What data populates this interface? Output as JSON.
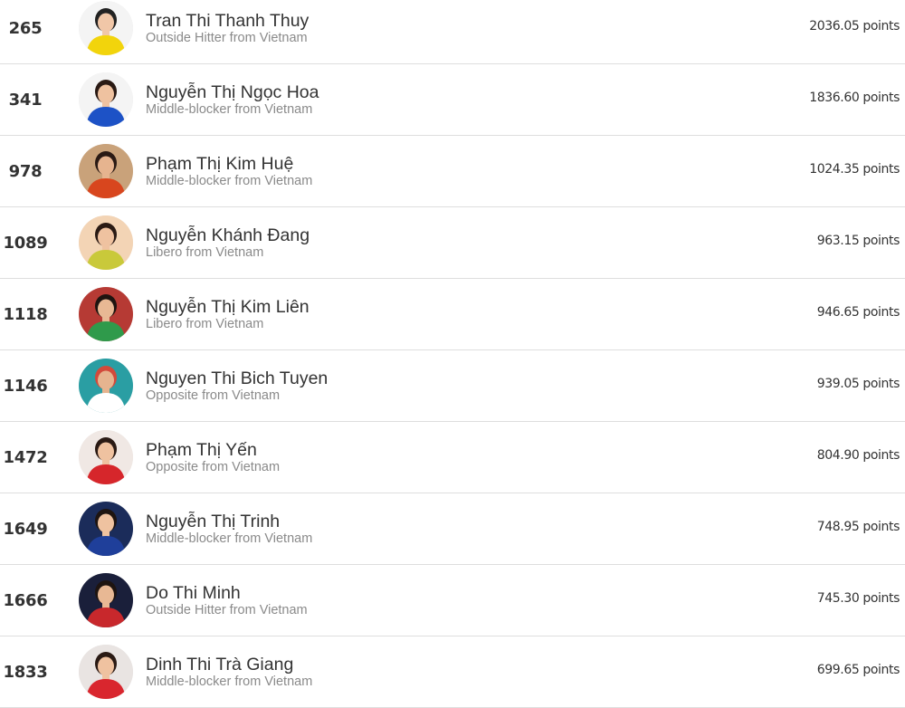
{
  "players": [
    {
      "rank": "265",
      "name": "Tran Thi Thanh Thuy",
      "role": "Outside Hitter from Vietnam",
      "points": "2036.05 points",
      "bg": "#f4f4f4",
      "shirt": "#f2d40c",
      "hair": "#222222",
      "skin": "#f1c7a8",
      "photo_icon": "player-avatar-icon"
    },
    {
      "rank": "341",
      "name": "Nguyễn Thị Ngọc Hoa",
      "role": "Middle-blocker from Vietnam",
      "points": "1836.60 points",
      "bg": "#f4f4f4",
      "shirt": "#1d52c6",
      "hair": "#2a1a14",
      "skin": "#efc2a0",
      "photo_icon": "player-avatar-icon"
    },
    {
      "rank": "978",
      "name": "Phạm Thị Kim Huệ",
      "role": "Middle-blocker from Vietnam",
      "points": "1024.35 points",
      "bg": "#c9a27a",
      "shirt": "#d8461e",
      "hair": "#2a1a14",
      "skin": "#e6b48f",
      "photo_icon": "player-avatar-icon"
    },
    {
      "rank": "1089",
      "name": "Nguyễn Khánh Đang",
      "role": "Libero from Vietnam",
      "points": "963.15 points",
      "bg": "#f3d4b5",
      "shirt": "#c9c93a",
      "hair": "#2a1a14",
      "skin": "#efc2a0",
      "photo_icon": "player-avatar-icon"
    },
    {
      "rank": "1118",
      "name": "Nguyễn Thị Kim Liên",
      "role": "Libero from Vietnam",
      "points": "946.65 points",
      "bg": "#b63a34",
      "shirt": "#2f9a4b",
      "hair": "#1e1410",
      "skin": "#e8b894",
      "photo_icon": "player-avatar-icon"
    },
    {
      "rank": "1146",
      "name": "Nguyen Thi Bich Tuyen",
      "role": "Opposite from Vietnam",
      "points": "939.05 points",
      "bg": "#2a9ea3",
      "shirt": "#ffffff",
      "hair": "#d24a3b",
      "skin": "#e6b48f",
      "photo_icon": "player-avatar-icon"
    },
    {
      "rank": "1472",
      "name": "Phạm Thị Yến",
      "role": "Opposite from Vietnam",
      "points": "804.90 points",
      "bg": "#f0e8e4",
      "shirt": "#d6262b",
      "hair": "#2a1a14",
      "skin": "#efc2a0",
      "photo_icon": "player-avatar-icon"
    },
    {
      "rank": "1649",
      "name": "Nguyễn Thị Trinh",
      "role": "Middle-blocker from Vietnam",
      "points": "748.95 points",
      "bg": "#1b2c5a",
      "shirt": "#1f3f9a",
      "hair": "#1e1410",
      "skin": "#efc2a0",
      "photo_icon": "player-avatar-icon"
    },
    {
      "rank": "1666",
      "name": "Do Thi Minh",
      "role": "Outside Hitter from Vietnam",
      "points": "745.30 points",
      "bg": "#1a1f3a",
      "shirt": "#c8282c",
      "hair": "#1e1410",
      "skin": "#e8b894",
      "photo_icon": "player-avatar-icon"
    },
    {
      "rank": "1833",
      "name": "Dinh Thi Trà Giang",
      "role": "Middle-blocker from Vietnam",
      "points": "699.65 points",
      "bg": "#e9e4e2",
      "shirt": "#d9262e",
      "hair": "#2a1a14",
      "skin": "#efc2a0",
      "photo_icon": "player-avatar-icon"
    }
  ]
}
